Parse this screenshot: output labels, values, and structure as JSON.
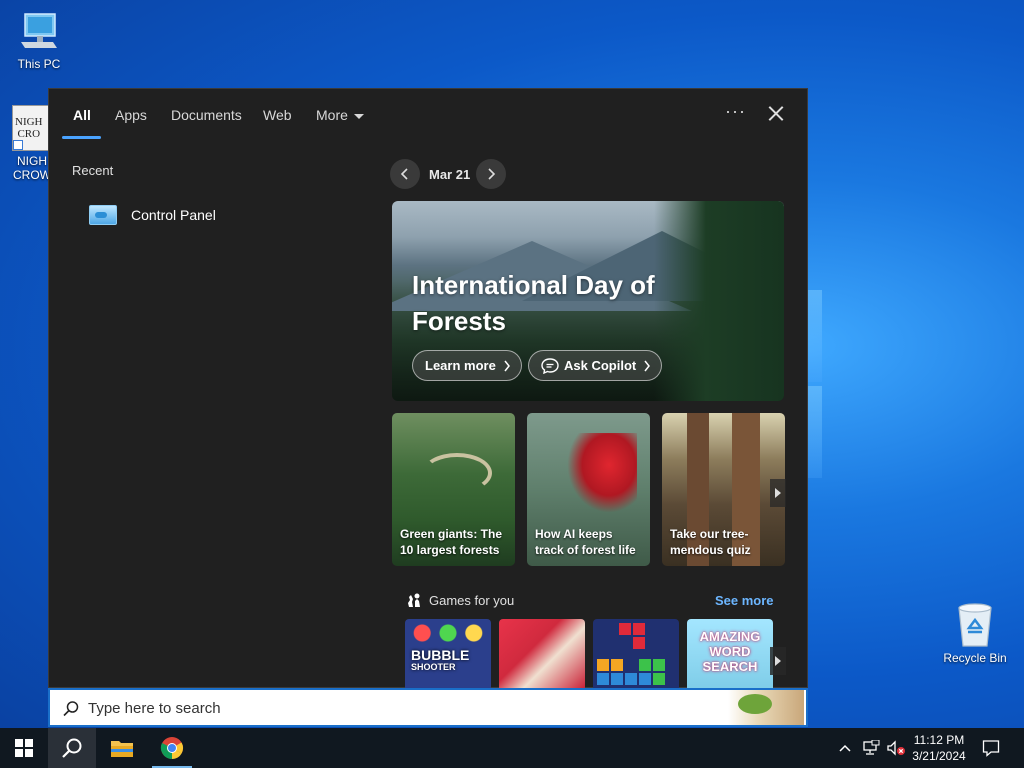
{
  "desktop": {
    "icons": [
      {
        "label": "This PC"
      },
      {
        "label": "NIGH CROW"
      },
      {
        "label": "Recycle Bin"
      }
    ],
    "night_crows_short": "NIGH\nCRO"
  },
  "search_window": {
    "tabs": [
      {
        "label": "All"
      },
      {
        "label": "Apps"
      },
      {
        "label": "Documents"
      },
      {
        "label": "Web"
      },
      {
        "label": "More"
      }
    ],
    "more_options": "···",
    "recent": {
      "title": "Recent",
      "items": [
        {
          "label": "Control Panel",
          "icon": "control-panel-icon"
        }
      ]
    },
    "highlights": {
      "date": "Mar 21",
      "hero": {
        "title": "International Day of Forests",
        "learn_more": "Learn more",
        "ask_copilot": "Ask Copilot"
      },
      "cards": [
        {
          "text": "Green giants: The 10 largest forests"
        },
        {
          "text": "How AI keeps track of forest life"
        },
        {
          "text": "Take our tree-mendous quiz"
        }
      ],
      "games": {
        "title": "Games for you",
        "see_more": "See more",
        "items": [
          {
            "title": "BUBBLE",
            "subtitle": "SHOOTER"
          },
          {
            "title": ""
          },
          {
            "title": ""
          },
          {
            "title": "AMAZING WORD SEARCH"
          }
        ]
      }
    }
  },
  "searchbox": {
    "placeholder": "Type here to search"
  },
  "taskbar": {
    "time": "11:12 PM",
    "date": "3/21/2024"
  },
  "colors": {
    "accent": "#4aa3ff",
    "link": "#6cb6ff",
    "panel_bg": "#202020",
    "taskbar_bg": "#101820"
  }
}
